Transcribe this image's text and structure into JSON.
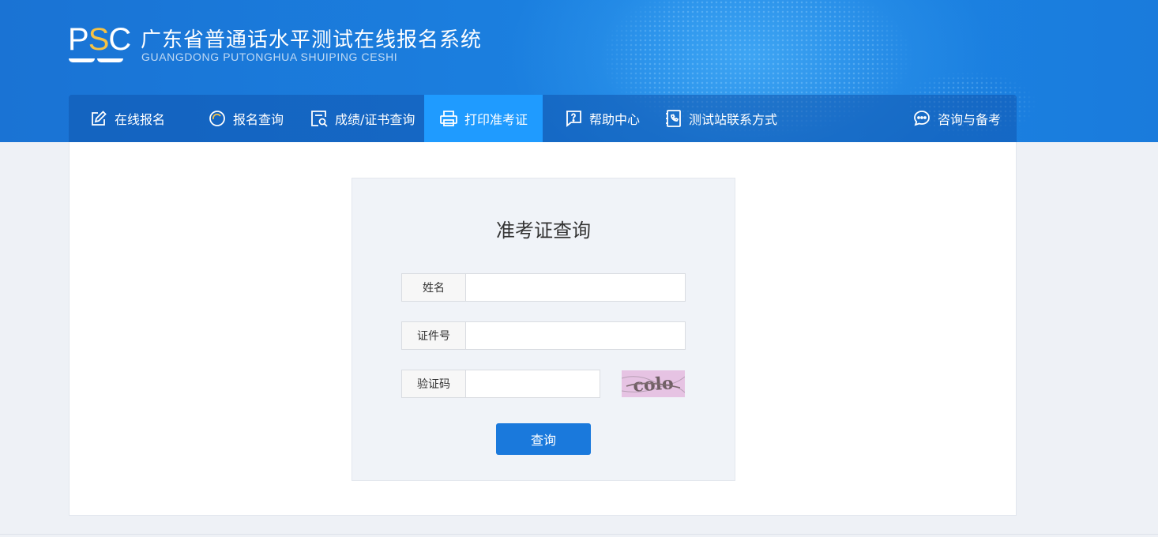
{
  "header": {
    "logo": {
      "left": "P",
      "middle": "S",
      "right": "C"
    },
    "title": "广东省普通话水平测试在线报名系统",
    "subtitle": "GUANGDONG PUTONGHUA SHUIPING CESHI"
  },
  "nav": {
    "items": [
      {
        "label": "在线报名",
        "icon": "edit-icon",
        "active": false
      },
      {
        "label": "报名查询",
        "icon": "search-circle-icon",
        "active": false
      },
      {
        "label": "成绩/证书查询",
        "icon": "document-search-icon",
        "active": false
      },
      {
        "label": "打印准考证",
        "icon": "printer-icon",
        "active": true
      },
      {
        "label": "帮助中心",
        "icon": "help-chat-icon",
        "active": false
      },
      {
        "label": "测试站联系方式",
        "icon": "phone-book-icon",
        "active": false
      }
    ],
    "right_item": {
      "label": "咨询与备考",
      "icon": "chat-bubble-icon"
    }
  },
  "form": {
    "title": "准考证查询",
    "name": {
      "label": "姓名",
      "value": "",
      "placeholder": ""
    },
    "id_number": {
      "label": "证件号",
      "value": "",
      "placeholder": ""
    },
    "captcha": {
      "label": "验证码",
      "value": "",
      "placeholder": "",
      "image_text": "colo"
    },
    "submit_label": "查询"
  },
  "colors": {
    "header_blue": "#1b7fdf",
    "nav_active": "#1f9bff",
    "button_blue": "#1a79dc",
    "logo_accent": "#f6c244",
    "panel_bg": "#f0f3f8"
  }
}
